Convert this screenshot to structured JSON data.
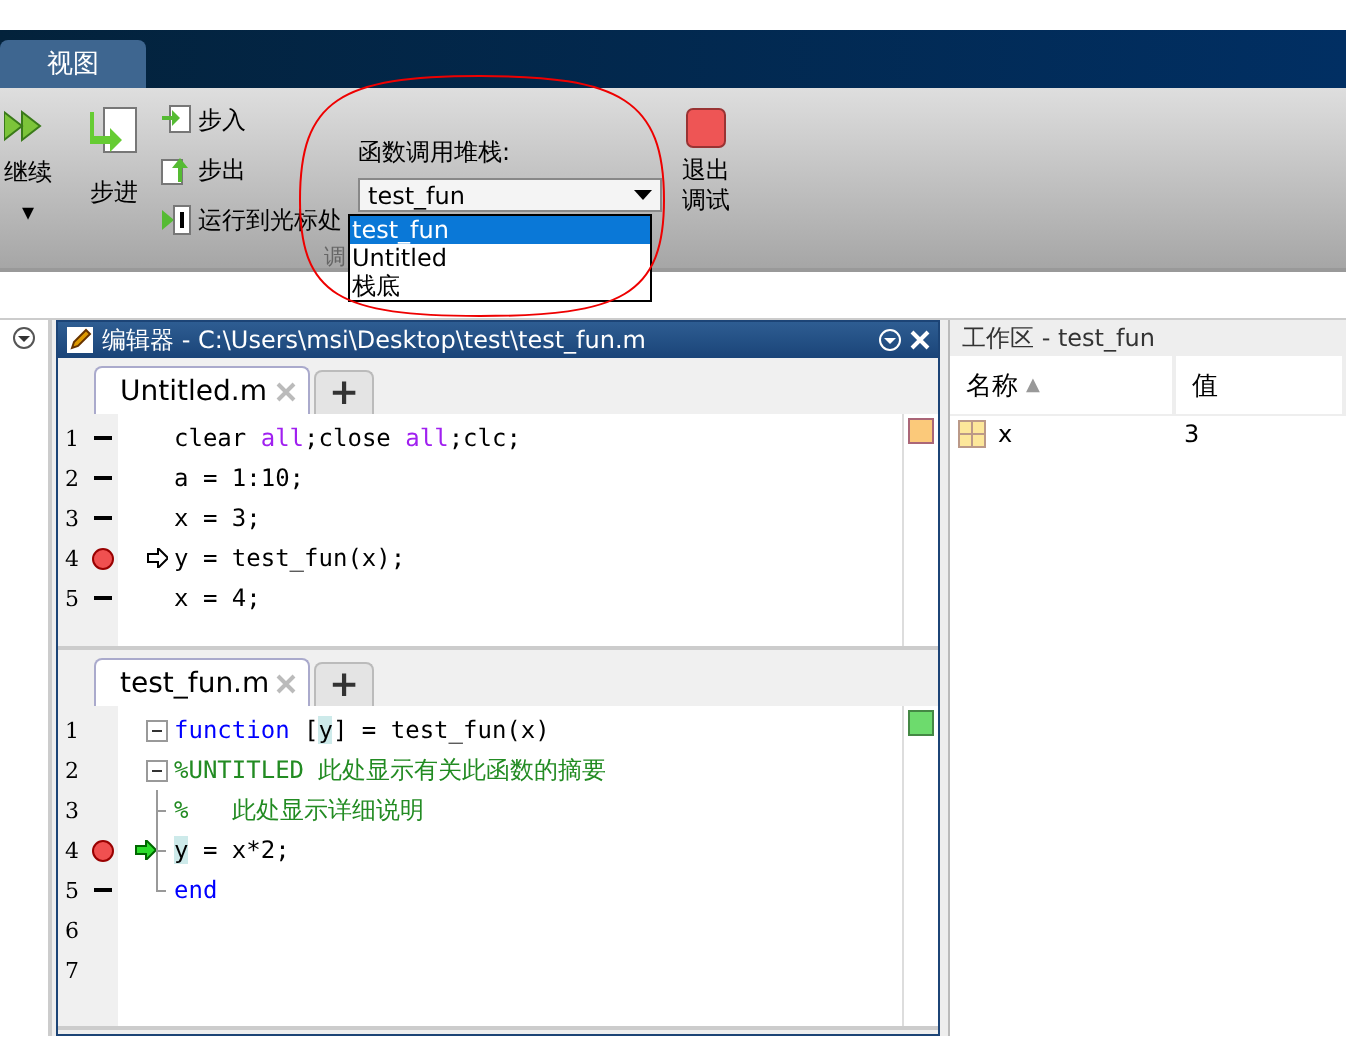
{
  "menu_tabs": [
    {
      "label": "视图",
      "selected": false
    }
  ],
  "ribbon": {
    "continue": {
      "label": "继续",
      "caret": "▾"
    },
    "step": {
      "label": "步进"
    },
    "small_buttons": [
      {
        "kind": "step_in",
        "label": "步入"
      },
      {
        "kind": "step_out",
        "label": "步出"
      },
      {
        "kind": "run_to_cursor",
        "label": "运行到光标处"
      }
    ],
    "call_stack": {
      "label": "函数调用堆栈:",
      "value": "test_fun",
      "options": [
        {
          "label": "test_fun",
          "selected": true
        },
        {
          "label": "Untitled",
          "selected": false
        },
        {
          "label": "栈底",
          "selected": false
        }
      ]
    },
    "exit": {
      "label": "退出调试"
    },
    "group_label": "调"
  },
  "editor": {
    "title": "编辑器 - C:\\Users\\msi\\Desktop\\test\\test_fun.m",
    "panes": [
      {
        "tab": "Untitled.m",
        "add": "+",
        "has_warnings": true,
        "active_frame": false,
        "lines": [
          {
            "number": "1",
            "executable": true,
            "breakpoint": false,
            "current": false,
            "tokens": [
              {
                "kind": "plain",
                "text": "clear "
              },
              {
                "kind": "string",
                "text": "all"
              },
              {
                "kind": "plain",
                "text": ";close "
              },
              {
                "kind": "string",
                "text": "all"
              },
              {
                "kind": "plain",
                "text": ";clc;"
              }
            ]
          },
          {
            "number": "2",
            "executable": true,
            "breakpoint": false,
            "current": false,
            "tokens": [
              {
                "kind": "plain",
                "text": "a = 1:10;"
              }
            ]
          },
          {
            "number": "3",
            "executable": true,
            "breakpoint": false,
            "current": false,
            "tokens": [
              {
                "kind": "plain",
                "text": "x = 3;"
              }
            ]
          },
          {
            "number": "4",
            "executable": true,
            "breakpoint": true,
            "current": true,
            "tokens": [
              {
                "kind": "plain",
                "text": "y = test_fun(x);"
              }
            ]
          },
          {
            "number": "5",
            "executable": true,
            "breakpoint": false,
            "current": false,
            "tokens": [
              {
                "kind": "plain",
                "text": "x = 4;"
              }
            ]
          }
        ]
      },
      {
        "tab": "test_fun.m",
        "add": "+",
        "has_warnings": false,
        "active_frame": true,
        "lines": [
          {
            "number": "1",
            "executable": false,
            "breakpoint": false,
            "current": false,
            "fold_start": true,
            "fold_end": false,
            "tokens": [
              {
                "kind": "keyword",
                "text": "function"
              },
              {
                "kind": "plain",
                "text": " ["
              },
              {
                "kind": "highlight",
                "text": "y"
              },
              {
                "kind": "plain",
                "text": "] = test_fun(x)"
              }
            ]
          },
          {
            "number": "2",
            "executable": false,
            "breakpoint": false,
            "current": false,
            "fold_start": true,
            "fold_end": false,
            "tokens": [
              {
                "kind": "comment",
                "text": "%UNTITLED 此处显示有关此函数的摘要"
              }
            ]
          },
          {
            "number": "3",
            "executable": false,
            "breakpoint": false,
            "current": false,
            "fold_start": false,
            "fold_end": false,
            "tokens": [
              {
                "kind": "comment",
                "text": "%   此处显示详细说明"
              }
            ]
          },
          {
            "number": "4",
            "executable": true,
            "breakpoint": true,
            "current": true,
            "fold_start": false,
            "fold_end": false,
            "tokens": [
              {
                "kind": "highlight",
                "text": "y"
              },
              {
                "kind": "plain",
                "text": " = x*2;"
              }
            ]
          },
          {
            "number": "5",
            "executable": true,
            "breakpoint": false,
            "current": false,
            "fold_start": false,
            "fold_end": true,
            "tokens": [
              {
                "kind": "keyword",
                "text": "end"
              }
            ]
          },
          {
            "number": "6",
            "executable": false,
            "breakpoint": false,
            "current": false,
            "fold_start": false,
            "fold_end": false
          },
          {
            "number": "7",
            "executable": false,
            "breakpoint": false,
            "current": false,
            "fold_start": false,
            "fold_end": false
          }
        ]
      }
    ]
  },
  "workspace": {
    "title": "工作区 - test_fun",
    "columns": [
      {
        "label": "名称",
        "sort": "▲"
      },
      {
        "label": "值"
      }
    ],
    "rows": [
      {
        "name": "x",
        "value": "3"
      }
    ]
  }
}
